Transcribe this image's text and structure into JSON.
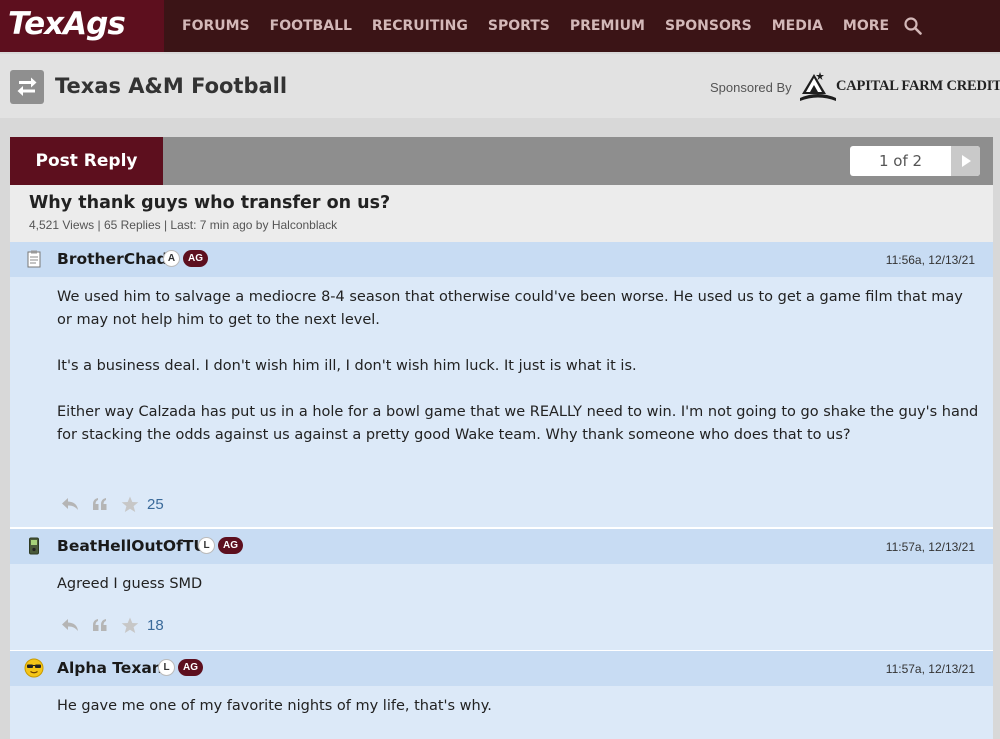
{
  "brand": {
    "logo_text": "TexAgs"
  },
  "nav": {
    "items": [
      "FORUMS",
      "FOOTBALL",
      "RECRUITING",
      "SPORTS",
      "PREMIUM",
      "SPONSORS",
      "MEDIA",
      "MORE"
    ]
  },
  "forum": {
    "title": "Texas A&M Football",
    "sponsored_by": "Sponsored By",
    "sponsor_name": "CAPITAL FARM CREDIT"
  },
  "thread": {
    "post_reply_label": "Post Reply",
    "pager_label": "1 of 2",
    "title": "Why thank guys who transfer on us?",
    "meta": "4,521 Views | 65 Replies | Last: 7 min ago by Halconblack"
  },
  "posts": [
    {
      "username": "BrotherChad",
      "badge_letter": "A",
      "badge_ag": "AG",
      "icon": "notepad-icon",
      "timestamp": "11:56a, 12/13/21",
      "paragraphs": [
        "We used him to salvage a mediocre 8-4 season that otherwise could've been worse. He used us to get a game film that may or may not help him to get to the next level.",
        "It's a business deal. I don't wish him ill, I don't wish him luck. It just is what it is.",
        "Either way Calzada has put us in a hole for a bowl game that we REALLY need to win. I'm not going to go shake the guy's hand for stacking the odds against us against a pretty good Wake team. Why thank someone who does that to us?"
      ],
      "stars": "25"
    },
    {
      "username": "BeatHellOutOfTU",
      "badge_letter": "L",
      "badge_ag": "AG",
      "icon": "phone-icon",
      "timestamp": "11:57a, 12/13/21",
      "paragraphs": [
        "Agreed I guess SMD"
      ],
      "stars": "18"
    },
    {
      "username": "Alpha Texan",
      "badge_letter": "L",
      "badge_ag": "AG",
      "icon": "sunglasses-face-icon",
      "timestamp": "11:57a, 12/13/21",
      "paragraphs": [
        "He gave me one of my favorite nights of my life, that's why."
      ],
      "stars": ""
    }
  ],
  "colors": {
    "maroon": "#5d0f1e",
    "nav_bg": "#3b1416",
    "post_bg": "#dce9f8",
    "post_head_bg": "#c8dcf3"
  }
}
